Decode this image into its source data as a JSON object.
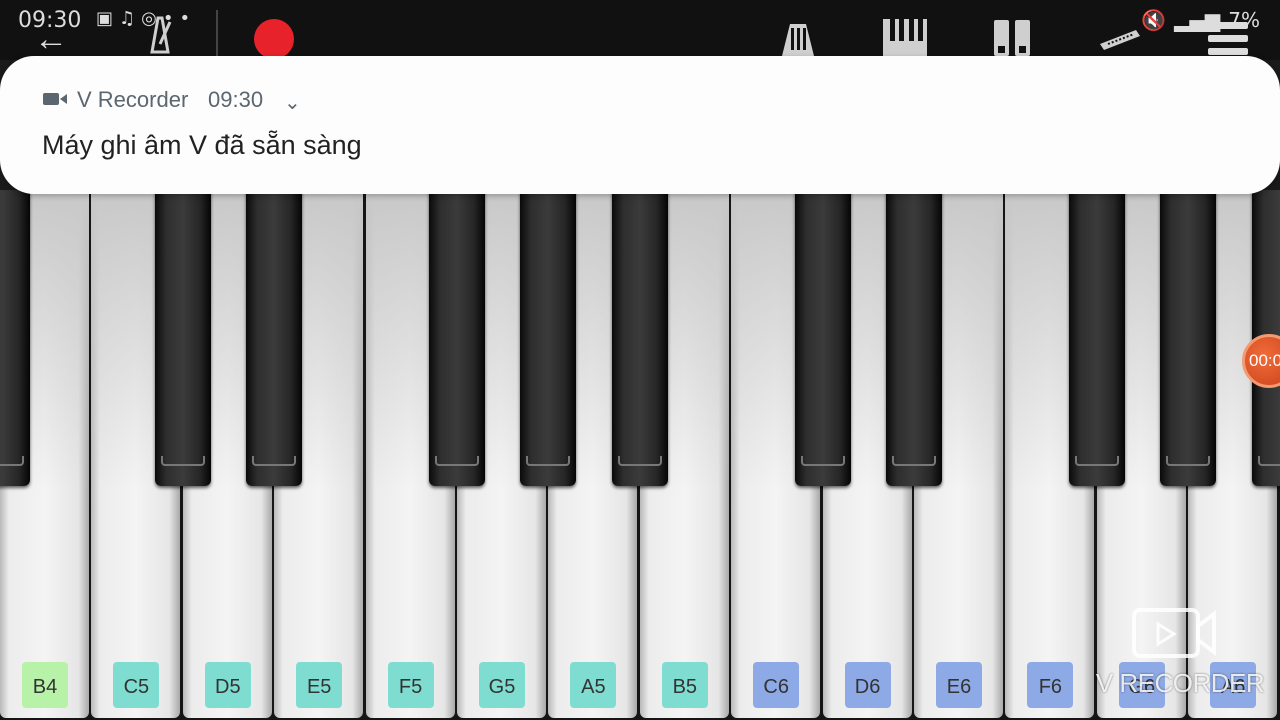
{
  "status_bar": {
    "time": "09:30",
    "icons": [
      "video-icon",
      "music-icon",
      "broadcast-icon",
      "dots-icon"
    ],
    "battery": "7%"
  },
  "toolbar": {
    "items": [
      "back-icon",
      "metronome-icon",
      "record-button",
      "sustain-pedal-icon",
      "keys-icon",
      "split-icon",
      "keyboard-icon",
      "menu-icon"
    ],
    "record_color": "#e8222b"
  },
  "notification": {
    "app_name": "V Recorder",
    "time": "09:30",
    "message": "Máy ghi âm V đã sẵn sàng"
  },
  "piano": {
    "white_keys": [
      {
        "note": "B4",
        "color": "#b8f2a8"
      },
      {
        "note": "C5",
        "color": "#7fdcd0"
      },
      {
        "note": "D5",
        "color": "#7fdcd0"
      },
      {
        "note": "E5",
        "color": "#7fdcd0"
      },
      {
        "note": "F5",
        "color": "#7fdcd0"
      },
      {
        "note": "G5",
        "color": "#7fdcd0"
      },
      {
        "note": "A5",
        "color": "#7fdcd0"
      },
      {
        "note": "B5",
        "color": "#7fdcd0"
      },
      {
        "note": "C6",
        "color": "#8eaae6"
      },
      {
        "note": "D6",
        "color": "#8eaae6"
      },
      {
        "note": "E6",
        "color": "#8eaae6"
      },
      {
        "note": "F6",
        "color": "#8eaae6"
      },
      {
        "note": "G6",
        "color": "#8eaae6"
      },
      {
        "note": "A6",
        "color": "#8eaae6"
      }
    ]
  },
  "timer": {
    "text": "00:0"
  },
  "watermark": {
    "text": "V RECORDER"
  }
}
